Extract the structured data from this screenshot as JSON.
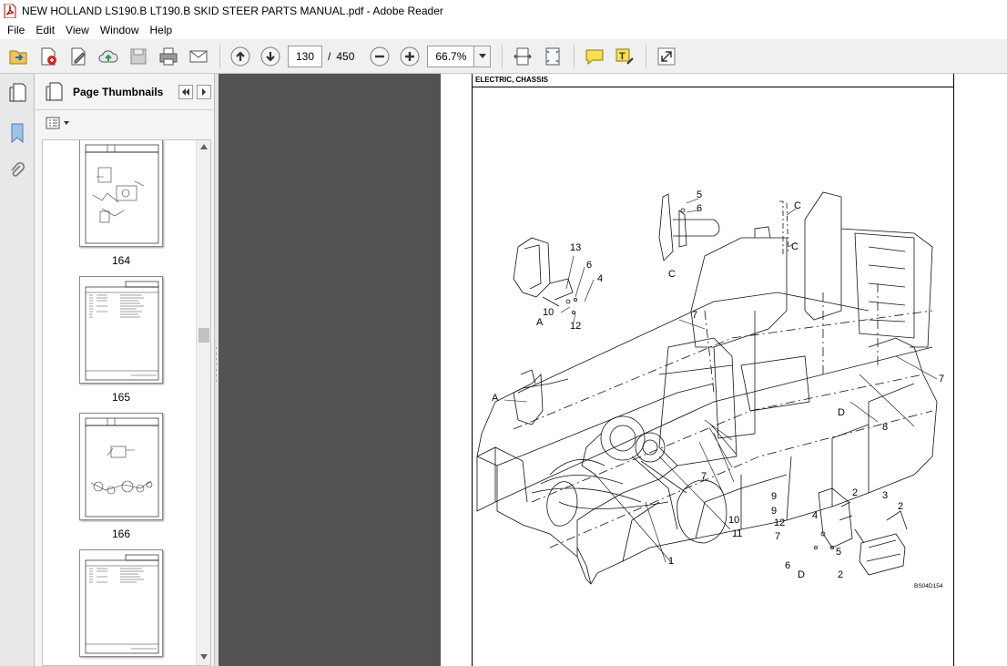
{
  "window": {
    "title": "NEW HOLLAND LS190.B LT190.B SKID STEER  PARTS MANUAL.pdf - Adobe Reader"
  },
  "menu": [
    "File",
    "Edit",
    "View",
    "Window",
    "Help"
  ],
  "toolbar": {
    "current_page": "130",
    "page_separator": "/",
    "total_pages": "450",
    "zoom": "66.7%"
  },
  "panel": {
    "title": "Page Thumbnails"
  },
  "thumbnails": [
    {
      "label": "164"
    },
    {
      "label": "165"
    },
    {
      "label": "166"
    },
    {
      "label": ""
    }
  ],
  "document": {
    "section_title": "ELECTRIC, CHASSIS",
    "figure_code": "BS04D154",
    "callouts": [
      "5",
      "6",
      "C",
      "C",
      "C",
      "13",
      "6",
      "4",
      "10",
      "A",
      "12",
      "7",
      "A",
      "7",
      "D",
      "7",
      "8",
      "9",
      "9",
      "10",
      "12",
      "11",
      "7",
      "1",
      "2",
      "3",
      "2",
      "4",
      "5",
      "6",
      "D",
      "2"
    ]
  }
}
